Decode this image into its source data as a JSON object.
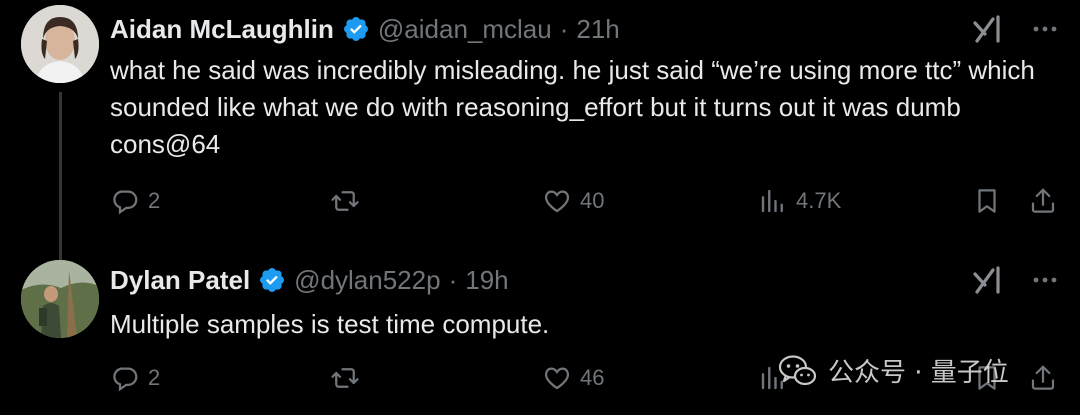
{
  "tweets": [
    {
      "author": "Aidan McLaughlin",
      "handle": "@aidan_mclau",
      "separator": "·",
      "time": "21h",
      "text": "what he said was incredibly misleading. he just said “we’re using more ttc” which sounded like what we do with reasoning_effort but it turns out it was dumb cons@64",
      "replies": "2",
      "reposts": "",
      "likes": "40",
      "views": "4.7K"
    },
    {
      "author": "Dylan Patel",
      "handle": "@dylan522p",
      "separator": "·",
      "time": "19h",
      "text": "Multiple samples is test time compute.",
      "replies": "2",
      "reposts": "",
      "likes": "46",
      "views": ""
    }
  ],
  "watermark": {
    "text": "公众号 · 量子位"
  },
  "icons": {
    "verified": "verified-badge-icon",
    "grok": "grok-icon",
    "more": "more-icon",
    "reply": "reply-icon",
    "repost": "repost-icon",
    "like": "like-icon",
    "views": "views-icon",
    "bookmark": "bookmark-icon",
    "share": "share-icon"
  },
  "colors": {
    "background": "#000000",
    "text": "#e7e9ea",
    "muted": "#71767b",
    "verified": "#1d9bf0",
    "thread_line": "#333639"
  }
}
